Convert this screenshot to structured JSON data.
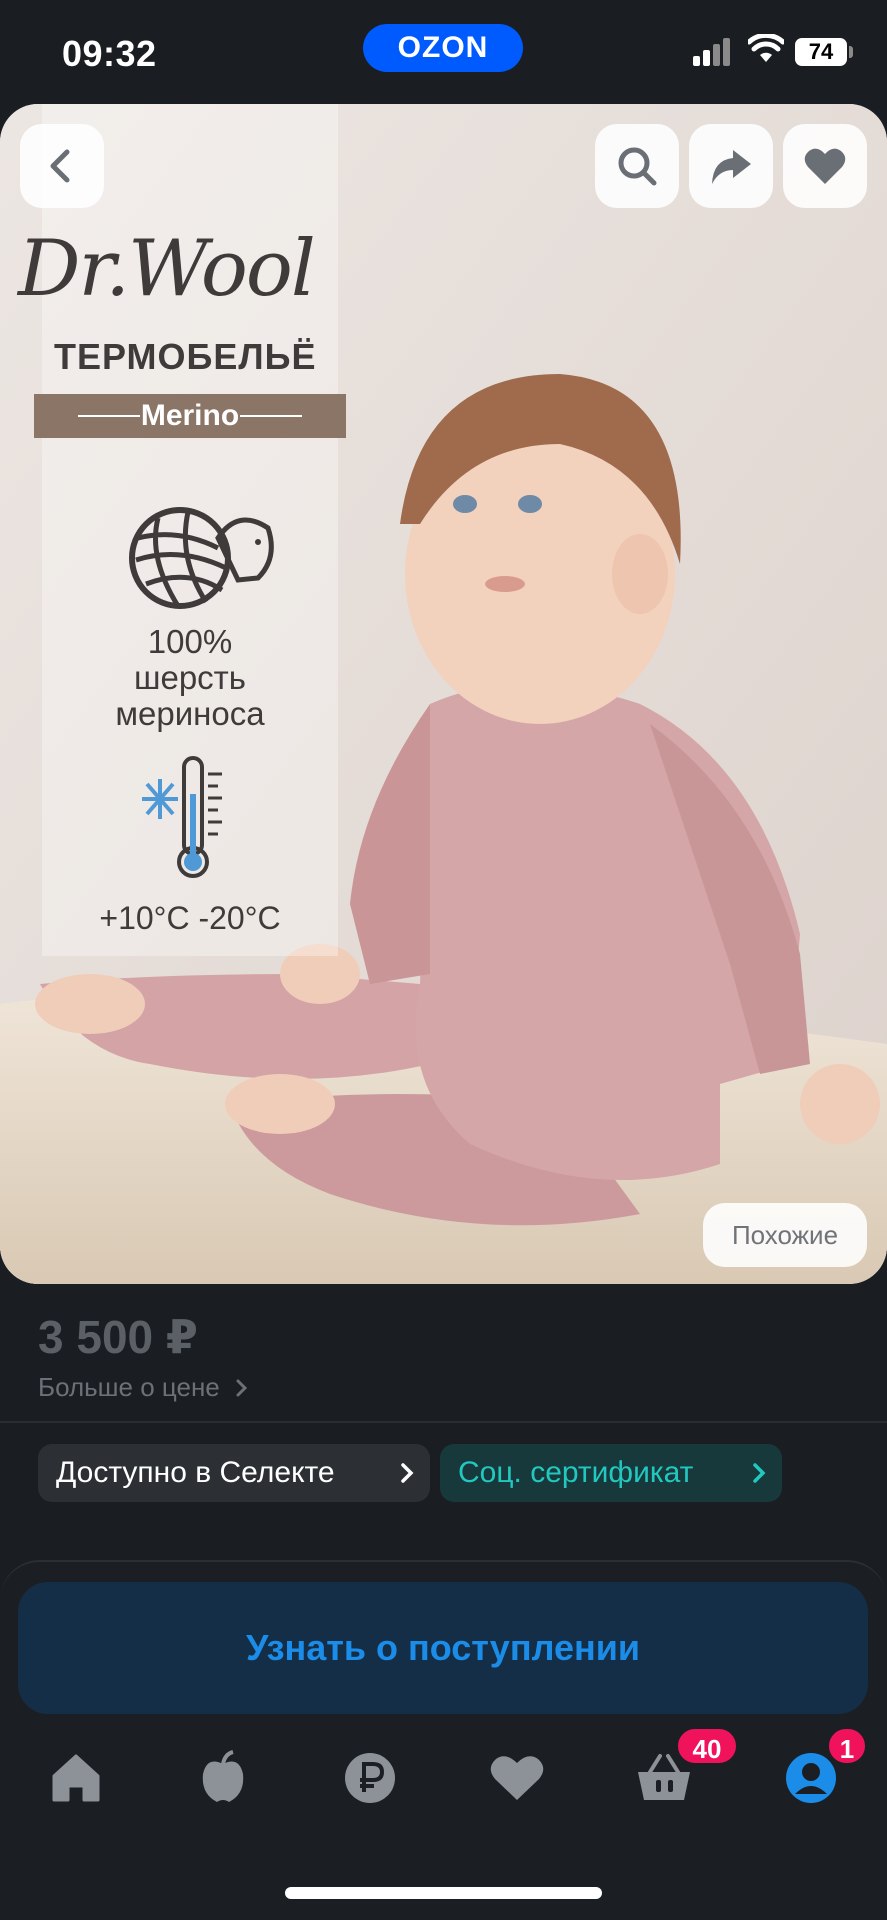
{
  "status_bar": {
    "time": "09:32",
    "app_label": "OZON",
    "battery": "74"
  },
  "hero": {
    "brand": "Dr.Wool",
    "subtitle": "ТЕРМОБЕЛЬЁ",
    "tag": "Merino",
    "wool_line1": "100%",
    "wool_line2": "шерсть",
    "wool_line3": "мериноса",
    "temperature": "+10°C -20°C",
    "similar_label": "Похожие"
  },
  "product": {
    "price": "3 500 ₽",
    "more_price": "Больше о цене",
    "chip_select": "Доступно в Селекте",
    "chip_cert": "Соц. сертификат"
  },
  "action": {
    "notify_label": "Узнать о поступлении"
  },
  "nav": {
    "cart_count": "40",
    "profile_count": "1"
  },
  "colors": {
    "accent": "#005bff",
    "notify_text": "#1b8de8",
    "badge": "#f0135b",
    "cert": "#22c8c0"
  }
}
